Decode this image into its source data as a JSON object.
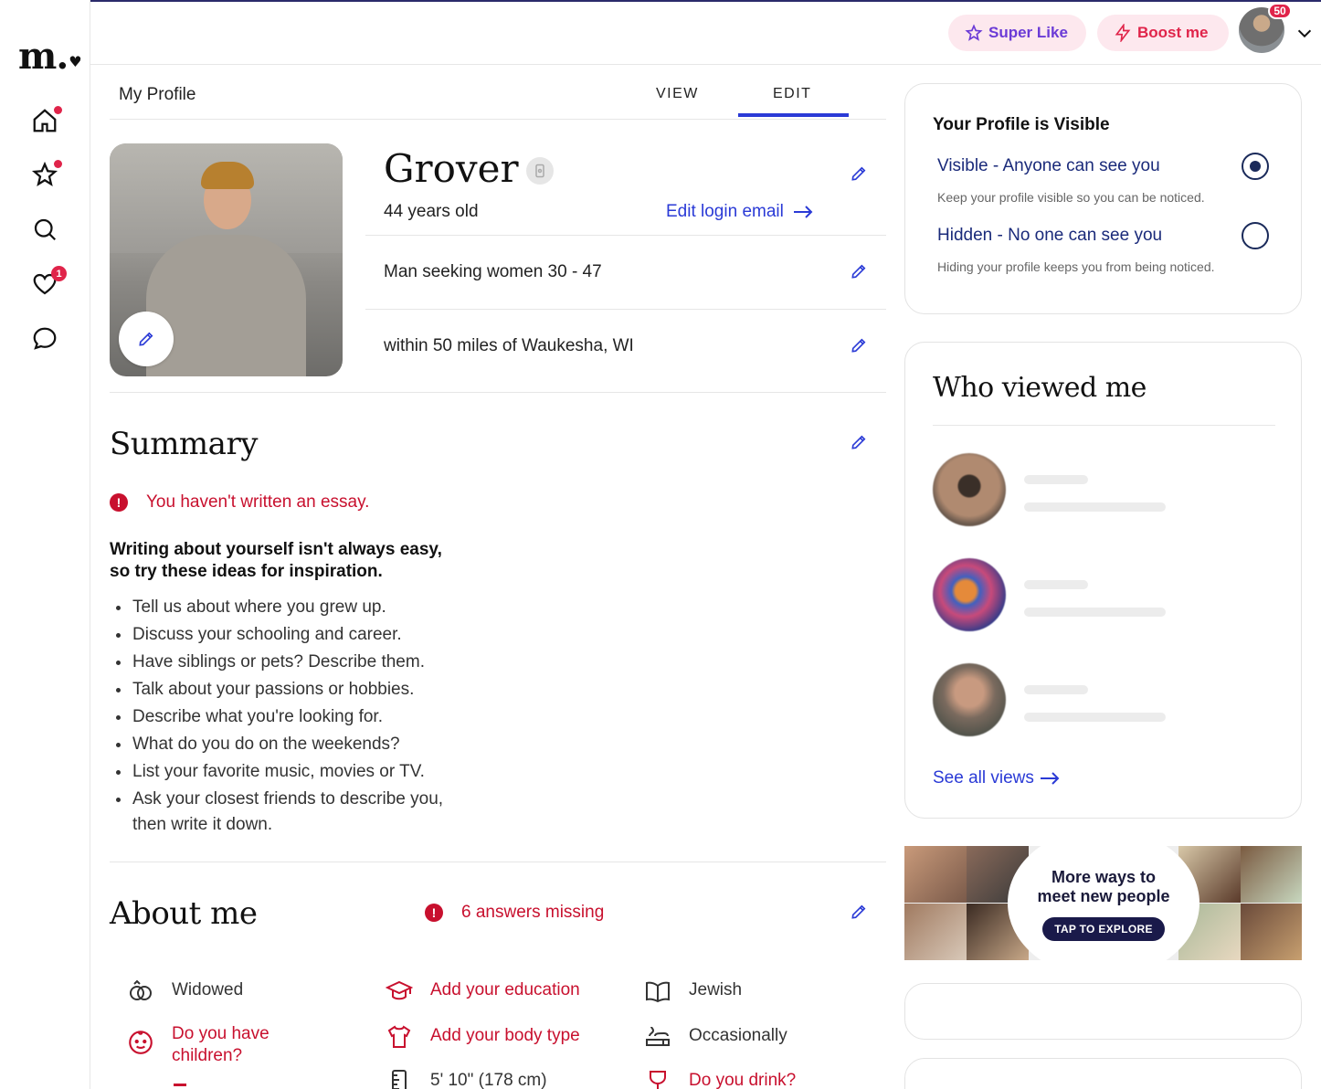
{
  "app": {
    "logo": "m."
  },
  "header": {
    "super_like_label": "Super Like",
    "boost_label": "Boost me",
    "notification_count": "50"
  },
  "sidebar": {
    "likes_badge": "1"
  },
  "tabs": {
    "page_title": "My Profile",
    "view_label": "VIEW",
    "edit_label": "EDIT",
    "active": "EDIT"
  },
  "profile": {
    "name": "Grover",
    "age": "44 years old",
    "edit_login_email": "Edit login email",
    "seeking": "Man seeking women 30 - 47",
    "location": "within 50 miles of Waukesha, WI"
  },
  "summary": {
    "title": "Summary",
    "warning": "You haven't written an essay.",
    "tips_heading_line1": "Writing about yourself isn't always easy,",
    "tips_heading_line2": "so try these ideas for inspiration.",
    "tips": [
      "Tell us about where you grew up.",
      "Discuss your schooling and career.",
      "Have siblings or pets? Describe them.",
      "Talk about your passions or hobbies.",
      "Describe what you're looking for.",
      "What do you do on the weekends?",
      "List your favorite music, movies or TV.",
      "Ask your closest friends to describe you,"
    ],
    "tips_continuation": "then write it down."
  },
  "about": {
    "title": "About me",
    "missing": "6 answers missing",
    "items": [
      {
        "label": "Widowed",
        "icon": "rings-icon",
        "state": "answered"
      },
      {
        "label": "Add your education",
        "icon": "graduation-cap-icon",
        "state": "missing"
      },
      {
        "label": "Jewish",
        "icon": "book-icon",
        "state": "answered"
      },
      {
        "label": "Do you have children?",
        "icon": "child-face-icon",
        "state": "missing"
      },
      {
        "label": "Add your body type",
        "icon": "shirt-icon",
        "state": "missing"
      },
      {
        "label": "Occasionally",
        "icon": "smoking-icon",
        "state": "answered"
      },
      {
        "label": "5' 10\" (178 cm)",
        "icon": "ruler-icon",
        "state": "answered"
      },
      {
        "label": "Do you drink?",
        "icon": "wine-glass-icon",
        "state": "missing"
      }
    ]
  },
  "visibility": {
    "title": "Your Profile is Visible",
    "visible_label": "Visible - Anyone can see you",
    "visible_desc": "Keep your profile visible so you can be noticed.",
    "hidden_label": "Hidden - No one can see you",
    "hidden_desc": "Hiding your profile keeps you from being noticed.",
    "selected": "visible"
  },
  "who_viewed": {
    "title": "Who viewed me",
    "see_all": "See all views"
  },
  "banner": {
    "headline_line1": "More ways to",
    "headline_line2": "meet new people",
    "cta": "TAP TO EXPLORE"
  },
  "colors": {
    "accent_blue": "#2a3ad6",
    "alert_red": "#c8102e",
    "badge_red": "#e0244a",
    "super_like_purple": "#6b3bd6",
    "pill_bg": "#fde8ee"
  }
}
